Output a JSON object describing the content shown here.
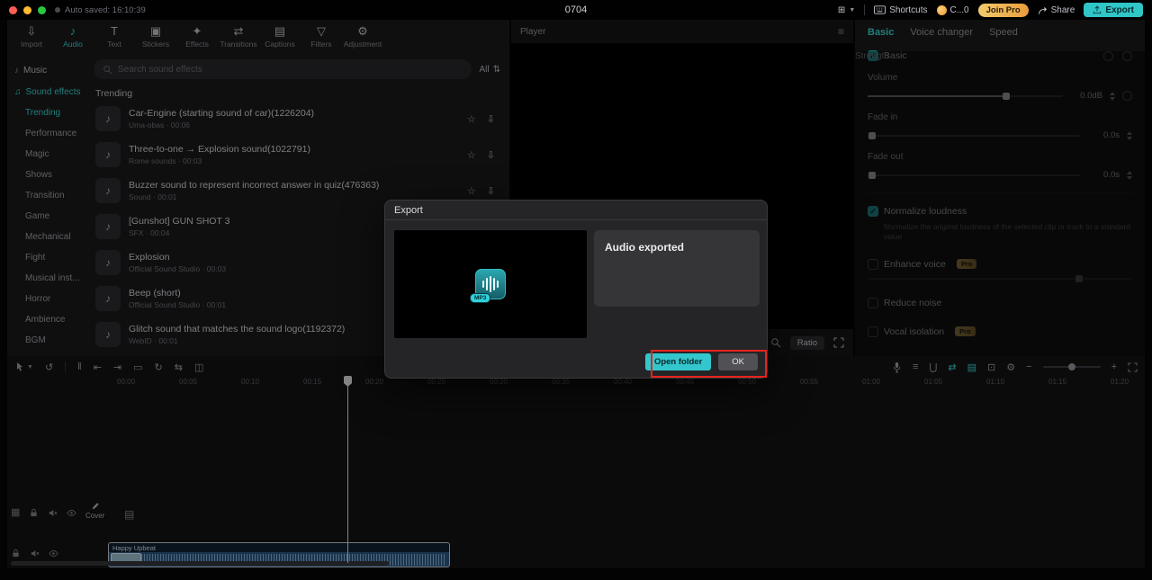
{
  "topbar": {
    "autosave": "Auto saved: 16:10:39",
    "title": "0704",
    "shortcuts_label": "Shortcuts",
    "credits_label": "C...0",
    "join_pro_label": "Join Pro",
    "share_label": "Share",
    "export_label": "Export"
  },
  "media_nav": {
    "items": [
      {
        "name": "nav-import",
        "label": "Import",
        "icon": "⇩"
      },
      {
        "name": "nav-audio",
        "label": "Audio",
        "icon": "♪",
        "active": true
      },
      {
        "name": "nav-text",
        "label": "Text",
        "icon": "T"
      },
      {
        "name": "nav-stickers",
        "label": "Stickers",
        "icon": "▣"
      },
      {
        "name": "nav-effects",
        "label": "Effects",
        "icon": "✦"
      },
      {
        "name": "nav-transitions",
        "label": "Transitions",
        "icon": "⇄"
      },
      {
        "name": "nav-captions",
        "label": "Captions",
        "icon": "▤"
      },
      {
        "name": "nav-filters",
        "label": "Filters",
        "icon": "▽"
      },
      {
        "name": "nav-adjustment",
        "label": "Adjustment",
        "icon": "⚙"
      }
    ]
  },
  "sidebar": {
    "groups": [
      {
        "name": "sidebar-item-music",
        "label": "Music",
        "icon": "♪"
      },
      {
        "name": "sidebar-item-sound-effects",
        "label": "Sound effects",
        "icon": "♫",
        "active": true
      }
    ],
    "categories": [
      {
        "name": "sidebar-item-trending",
        "label": "Trending",
        "active": true
      },
      {
        "name": "sidebar-item-performance",
        "label": "Performance"
      },
      {
        "name": "sidebar-item-magic",
        "label": "Magic"
      },
      {
        "name": "sidebar-item-shows",
        "label": "Shows"
      },
      {
        "name": "sidebar-item-transition",
        "label": "Transition"
      },
      {
        "name": "sidebar-item-game",
        "label": "Game"
      },
      {
        "name": "sidebar-item-mechanical",
        "label": "Mechanical"
      },
      {
        "name": "sidebar-item-fight",
        "label": "Fight"
      },
      {
        "name": "sidebar-item-musical-inst",
        "label": "Musical inst..."
      },
      {
        "name": "sidebar-item-horror",
        "label": "Horror"
      },
      {
        "name": "sidebar-item-ambience",
        "label": "Ambience"
      },
      {
        "name": "sidebar-item-bgm",
        "label": "BGM"
      }
    ]
  },
  "search": {
    "placeholder": "Search sound effects",
    "filter_label": "All"
  },
  "sound_list": {
    "section_title": "Trending",
    "items": [
      {
        "title": "Car-Engine (starting sound of car)(1226204)",
        "meta": "Uma-obas · 00:06"
      },
      {
        "title": "Three-to-one → Explosion sound(1022791)",
        "meta": "Rome sounds · 00:03"
      },
      {
        "title": "Buzzer sound to represent incorrect answer in quiz(476363)",
        "meta": "Sound · 00:01"
      },
      {
        "title": "[Gunshot] GUN SHOT 3",
        "meta": "SFX · 00:04"
      },
      {
        "title": "Explosion",
        "meta": "Official Sound Studio · 00:03"
      },
      {
        "title": "Beep (short)",
        "meta": "Official Sound Studio · 00:01"
      },
      {
        "title": "Glitch sound that matches the sound logo(1192372)",
        "meta": "WebID · 00:01"
      }
    ]
  },
  "player": {
    "label": "Player",
    "ratio_label": "Ratio"
  },
  "inspector": {
    "tabs": [
      {
        "name": "tab-basic",
        "label": "Basic",
        "active": true
      },
      {
        "name": "tab-voice-changer",
        "label": "Voice changer"
      },
      {
        "name": "tab-speed",
        "label": "Speed"
      }
    ],
    "basic_label": "Basic",
    "volume": {
      "label": "Volume",
      "value": "0.0dB"
    },
    "fade_in": {
      "label": "Fade in",
      "value": "0.0s"
    },
    "fade_out": {
      "label": "Fade out",
      "value": "0.0s"
    },
    "normalize": {
      "label": "Normalize loudness",
      "desc": "Normalize the original loudness of the selected clip or track to a standard value"
    },
    "enhance": {
      "label": "Enhance voice",
      "badge": "Pro",
      "strength_label": "Strength"
    },
    "reduce": {
      "label": "Reduce noise"
    },
    "vocal": {
      "label": "Vocal isolation",
      "badge": "Pro"
    }
  },
  "dialog": {
    "title": "Export",
    "status": "Audio exported",
    "file_badge": "MP3",
    "open_folder_label": "Open folder",
    "ok_label": "OK"
  },
  "timeline": {
    "ruler_labels": [
      "00:00",
      "00:05",
      "00:10",
      "00:15",
      "00:20",
      "00:25",
      "00:30",
      "00:35",
      "00:40",
      "00:45",
      "00:50",
      "00:55",
      "01:00",
      "01:05",
      "01:10",
      "01:15",
      "01:20"
    ],
    "cover_label": "Cover",
    "clip_title": "Happy Upbeat"
  },
  "colors": {
    "accent": "#30c6c8",
    "annotation_red": "#e5231d",
    "pro_badge": "#c9a55e",
    "join_pro": "#eeb44a",
    "clip_blue": "#2d5a85"
  }
}
